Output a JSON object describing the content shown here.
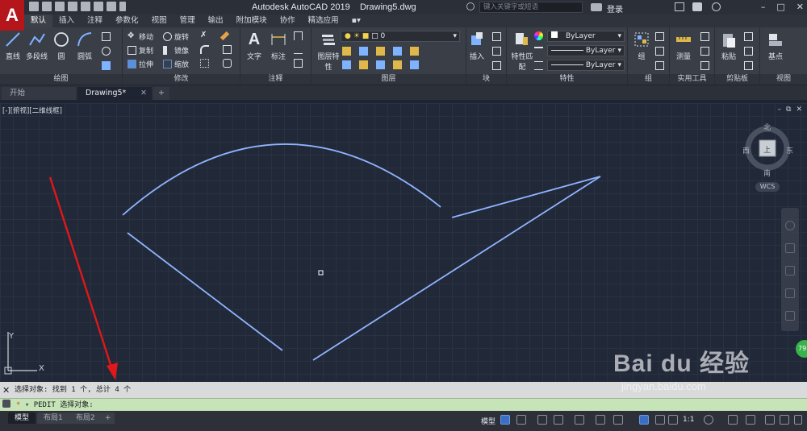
{
  "titlebar": {
    "app_name": "Autodesk AutoCAD 2019",
    "file_name": "Drawing5.dwg",
    "search_placeholder": "键入关键字或短语",
    "login": "登录",
    "logo_letter": "A"
  },
  "ribbon_tabs": [
    "默认",
    "插入",
    "注释",
    "参数化",
    "视图",
    "管理",
    "输出",
    "附加模块",
    "协作",
    "精选应用"
  ],
  "ribbon": {
    "draw": {
      "title": "绘图",
      "line": "直线",
      "polyline": "多段线",
      "circle": "圆",
      "arc": "圆弧"
    },
    "modify": {
      "title": "修改",
      "move": "移动",
      "rotate": "旋转",
      "copy": "复制",
      "mirror": "镜像",
      "stretch": "拉伸",
      "scale": "缩放"
    },
    "annotation": {
      "title": "注释",
      "text": "文字",
      "dimension": "标注"
    },
    "layers": {
      "title": "图层",
      "properties": "图层特性",
      "current_layer": "0"
    },
    "block": {
      "title": "块",
      "insert": "插入"
    },
    "properties": {
      "title": "特性",
      "match": "特性匹配",
      "color": "ByLayer",
      "linetype": "ByLayer",
      "lineweight": "ByLayer"
    },
    "groups": {
      "title": "组",
      "group": "组"
    },
    "utilities": {
      "title": "实用工具",
      "measure": "测量"
    },
    "clipboard": {
      "title": "剪贴板",
      "paste": "粘贴"
    },
    "view": {
      "title": "视图",
      "base": "基点"
    }
  },
  "file_tabs": {
    "start": "开始",
    "drawing": "Drawing5*",
    "add": "+"
  },
  "viewport": {
    "label": "[-][俯视][二维线框]",
    "compass": {
      "north": "北",
      "south": "南",
      "east": "东",
      "west": "西",
      "top": "上"
    },
    "wcs": "WCS"
  },
  "command": {
    "history": "选择对象: 找到 1 个, 总计 4 个",
    "prompt": "PEDIT 选择对象:",
    "prompt_marker": "*"
  },
  "layout_tabs": [
    "模型",
    "布局1",
    "布局2",
    "+"
  ],
  "status": {
    "model": "模型",
    "scale": "1:1"
  },
  "badge": "79",
  "watermark": {
    "main": "Bai du 经验",
    "sub": "jingyan.baidu.com"
  },
  "colors": {
    "accent_red": "#b4161b",
    "line_color": "#8fb4ff",
    "arrow": "#e0171b"
  }
}
